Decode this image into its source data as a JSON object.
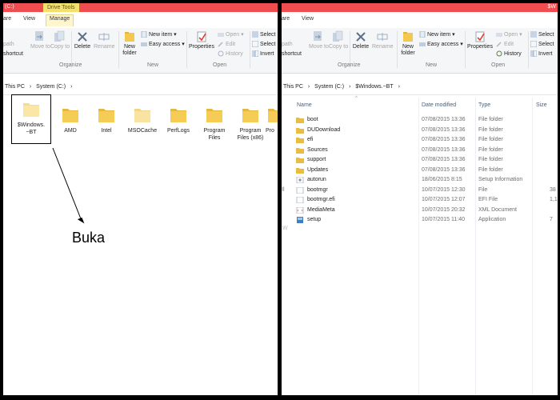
{
  "left_window": {
    "title_fragment": "(C:)",
    "drive_tools_label": "Drive Tools",
    "tabs": [
      "are",
      "View",
      "Manage"
    ],
    "ribbon": {
      "path_label": "path",
      "shortcut_label": "shortcut",
      "move_to": "Move to",
      "copy_to": "Copy to",
      "delete": "Delete",
      "rename": "Rename",
      "new_folder": "New folder",
      "new_item": "New item",
      "easy_access": "Easy access",
      "properties": "Properties",
      "open": "Open",
      "edit": "Edit",
      "history": "History",
      "select_all": "Select",
      "select_none": "Select",
      "invert": "Invert",
      "group_organize": "Organize",
      "group_new": "New",
      "group_open": "Open"
    },
    "address": [
      "This PC",
      "›",
      "System (C:)",
      "›"
    ],
    "folders": [
      {
        "name": "$Windows.~BT",
        "line1": "$Windows.",
        "line2": "~BT"
      },
      {
        "name": "AMD",
        "line1": "AMD",
        "line2": ""
      },
      {
        "name": "Intel",
        "line1": "Intel",
        "line2": ""
      },
      {
        "name": "MSOCache",
        "line1": "MSOCache",
        "line2": ""
      },
      {
        "name": "PerfLogs",
        "line1": "PerfLogs",
        "line2": ""
      },
      {
        "name": "Program Files",
        "line1": "Program",
        "line2": "Files"
      },
      {
        "name": "Program Files (x86)",
        "line1": "Program",
        "line2": "Files (x86)"
      },
      {
        "name": "Pro",
        "line1": "Pro",
        "line2": ""
      }
    ],
    "annotation": "Buka"
  },
  "right_window": {
    "title_fragment": "$W",
    "tabs": [
      "are",
      "View"
    ],
    "ribbon": {
      "path_label": "path",
      "shortcut_label": "shortcut",
      "move_to": "Move to",
      "copy_to": "Copy to",
      "delete": "Delete",
      "rename": "Rename",
      "new_folder": "New folder",
      "new_item": "New item",
      "easy_access": "Easy access",
      "properties": "Properties",
      "open": "Open",
      "edit": "Edit",
      "history": "History",
      "select_all": "Select",
      "select_none": "Select",
      "invert": "Invert",
      "group_organize": "Organize",
      "group_new": "New",
      "group_open": "Open"
    },
    "address": [
      "This PC",
      "›",
      "System (C:)",
      "›",
      "$Windows.~BT",
      "›"
    ],
    "columns": {
      "name": "Name",
      "date": "Date modified",
      "type": "Type",
      "size": "Size"
    },
    "files": [
      {
        "name": "boot",
        "date": "07/08/2015 13:36",
        "type": "File folder",
        "size": "",
        "icon": "folder-icon"
      },
      {
        "name": "DUDownload",
        "date": "07/08/2015 13:36",
        "type": "File folder",
        "size": "",
        "icon": "folder-icon"
      },
      {
        "name": "efi",
        "date": "07/08/2015 13:36",
        "type": "File folder",
        "size": "",
        "icon": "folder-icon"
      },
      {
        "name": "Sources",
        "date": "07/08/2015 13:36",
        "type": "File folder",
        "size": "",
        "icon": "folder-icon"
      },
      {
        "name": "support",
        "date": "07/08/2015 13:36",
        "type": "File folder",
        "size": "",
        "icon": "folder-icon"
      },
      {
        "name": "Updates",
        "date": "07/08/2015 13:36",
        "type": "File folder",
        "size": "",
        "icon": "folder-icon"
      },
      {
        "name": "autorun",
        "date": "18/06/2015 8:15",
        "type": "Setup Information",
        "size": "",
        "icon": "setup-info-icon"
      },
      {
        "name": "bootmgr",
        "date": "10/07/2015 12:30",
        "type": "File",
        "size": "38",
        "icon": "file-icon"
      },
      {
        "name": "bootmgr.efi",
        "date": "10/07/2015 12:07",
        "type": "EFI File",
        "size": "1,12",
        "icon": "file-icon"
      },
      {
        "name": "MediaMeta",
        "date": "10/07/2015 20:32",
        "type": "XML Document",
        "size": "",
        "icon": "xml-icon"
      },
      {
        "name": "setup",
        "date": "10/07/2015 11:40",
        "type": "Application",
        "size": "7",
        "icon": "app-icon"
      }
    ]
  }
}
